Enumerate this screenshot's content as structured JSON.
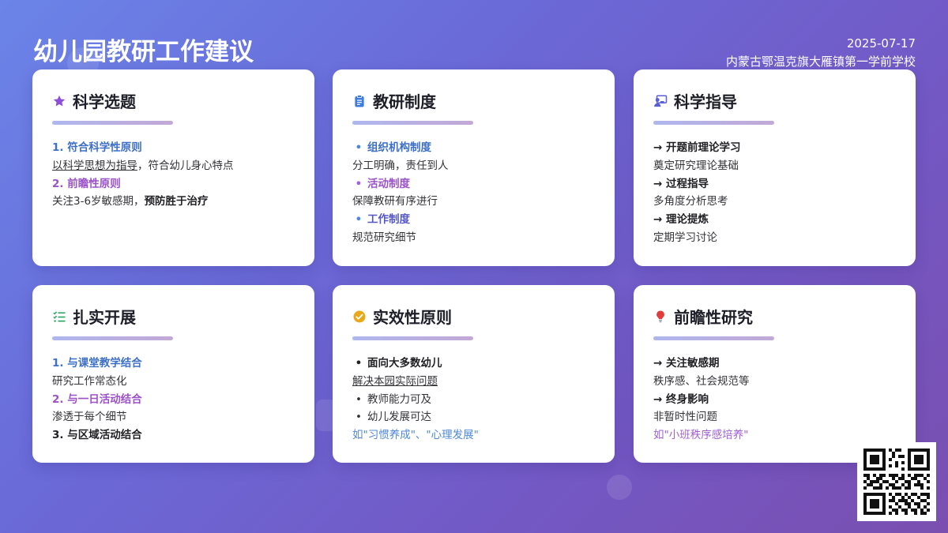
{
  "header": {
    "title": "幼儿园教研工作建议",
    "date": "2025-07-17",
    "school": "内蒙古鄂温克旗大雁镇第一学前学校"
  },
  "colors": {
    "accent_blue": "#3d6fc6",
    "accent_purple": "#9b52c9",
    "star_icon": "#8b4fd9",
    "clipboard_icon": "#3d7be0",
    "teacher_icon": "#5a5fd6",
    "checklist_icon": "#2ea561",
    "check_circle_icon": "#e6a91a",
    "bulb_icon": "#e03c3c"
  },
  "cards": [
    {
      "icon": "star-icon",
      "title": "科学选题",
      "l1": "1. 符合科学性原则",
      "l2_u": "以科学思想为指导",
      "l2_rest": "，符合幼儿身心特点",
      "l3": "2. 前瞻性原则",
      "l4_a": "关注3-6岁敏感期，",
      "l4_b": "预防胜于治疗"
    },
    {
      "icon": "clipboard-icon",
      "title": "教研制度",
      "b1": "•",
      "l1": "组织机构制度",
      "l2": "分工明确，责任到人",
      "b3": "•",
      "l3": "活动制度",
      "l4": "保障教研有序进行",
      "b5": "•",
      "l5": "工作制度",
      "l6": "规范研究细节"
    },
    {
      "icon": "teacher-icon",
      "title": "科学指导",
      "l1": "→ 开题前理论学习",
      "l2": "奠定研究理论基础",
      "l3": "→ 过程指导",
      "l4": "多角度分析思考",
      "l5": "→ 理论提炼",
      "l6": "定期学习讨论"
    },
    {
      "icon": "checklist-icon",
      "title": "扎实开展",
      "l1": "1. 与课堂教学结合",
      "l2": "研究工作常态化",
      "l3": "2. 与一日活动结合",
      "l4": "渗透于每个细节",
      "l5": "3. 与区域活动结合"
    },
    {
      "icon": "check-circle-icon",
      "title": "实效性原则",
      "b1": "•",
      "l1": "面向大多数幼儿",
      "l2": "解决本园实际问题",
      "b3": "•",
      "l3": "教师能力可及",
      "b4": "•",
      "l4": "幼儿发展可达",
      "l5": "如\"习惯养成\"、\"心理发展\""
    },
    {
      "icon": "bulb-icon",
      "title": "前瞻性研究",
      "l1": "→ 关注敏感期",
      "l2": "秩序感、社会规范等",
      "l3": "→ 终身影响",
      "l4": "非暂时性问题",
      "l5": "如\"小班秩序感培养\""
    }
  ],
  "qr": {
    "icon": "qr-code-icon"
  }
}
